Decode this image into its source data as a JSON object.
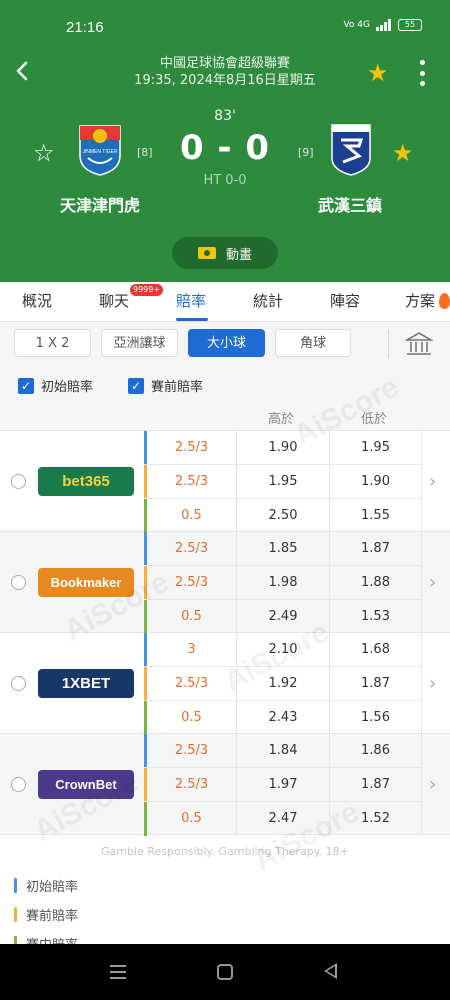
{
  "status_bar": {
    "time": "21:16",
    "signal": "Vo 4G",
    "battery": "55"
  },
  "match": {
    "league": "中國足球協會超級聯賽",
    "datetime": "19:35, 2024年8月16日星期五",
    "minute": "83'",
    "score": "0 - 0",
    "half_time": "HT 0-0",
    "home": {
      "name": "天津津門虎",
      "rank": "[8]",
      "logo_text": "JINMEN TIGER"
    },
    "away": {
      "name": "武漢三鎮",
      "rank": "[9]"
    },
    "animation_label": "動畫"
  },
  "tabs": [
    {
      "label": "概況"
    },
    {
      "label": "聊天",
      "badge": "9999+"
    },
    {
      "label": "賠率",
      "active": true
    },
    {
      "label": "統計"
    },
    {
      "label": "陣容"
    },
    {
      "label": "方案"
    }
  ],
  "market_filters": [
    {
      "label": "1 X 2"
    },
    {
      "label": "亞洲讓球"
    },
    {
      "label": "大小球",
      "active": true
    },
    {
      "label": "角球"
    }
  ],
  "checkboxes": [
    {
      "label": "初始賠率",
      "checked": true
    },
    {
      "label": "賽前賠率",
      "checked": true
    }
  ],
  "table_header": {
    "high": "高於",
    "low": "低於"
  },
  "bookmakers": [
    {
      "name": "bet365",
      "bg": "#1a7a4a",
      "text_color": "#f4d03f",
      "rows": [
        {
          "line": "2.5/3",
          "over": "1.90",
          "under": "1.95",
          "type": "initial"
        },
        {
          "line": "2.5/3",
          "over": "1.95",
          "under": "1.90",
          "type": "pre"
        },
        {
          "line": "0.5",
          "over": "2.50",
          "under": "1.55",
          "type": "live"
        }
      ]
    },
    {
      "name": "Bookmaker",
      "bg": "#e8891f",
      "text_color": "#ffffff",
      "rows": [
        {
          "line": "2.5/3",
          "over": "1.85",
          "under": "1.87",
          "type": "initial"
        },
        {
          "line": "2.5/3",
          "over": "1.98",
          "under": "1.88",
          "type": "pre"
        },
        {
          "line": "0.5",
          "over": "2.49",
          "under": "1.53",
          "type": "live"
        }
      ]
    },
    {
      "name": "1XBET",
      "bg": "#173866",
      "text_color": "#ffffff",
      "rows": [
        {
          "line": "3",
          "over": "2.10",
          "under": "1.68",
          "type": "initial"
        },
        {
          "line": "2.5/3",
          "over": "1.92",
          "under": "1.87",
          "type": "pre"
        },
        {
          "line": "0.5",
          "over": "2.43",
          "under": "1.56",
          "type": "live"
        }
      ]
    },
    {
      "name": "CrownBet",
      "bg": "#4b3a8c",
      "text_color": "#ffffff",
      "rows": [
        {
          "line": "2.5/3",
          "over": "1.84",
          "under": "1.86",
          "type": "initial"
        },
        {
          "line": "2.5/3",
          "over": "1.97",
          "under": "1.87",
          "type": "pre"
        },
        {
          "line": "0.5",
          "over": "2.47",
          "under": "1.52",
          "type": "live"
        }
      ]
    }
  ],
  "disclaimer": "Gamble Responsibly. Gambling Therapy. 18+",
  "legend": [
    {
      "label": "初始賠率",
      "type": "initial"
    },
    {
      "label": "賽前賠率",
      "type": "pre"
    },
    {
      "label": "賽中賠率",
      "type": "live"
    }
  ],
  "watermark": "AiScore",
  "colors": {
    "header_green": "#2e8b3d",
    "accent_blue": "#1f6bd6",
    "line_orange": "#e0702c",
    "initial": "#4a90e2",
    "pre": "#f5b041",
    "live": "#7cb342"
  }
}
